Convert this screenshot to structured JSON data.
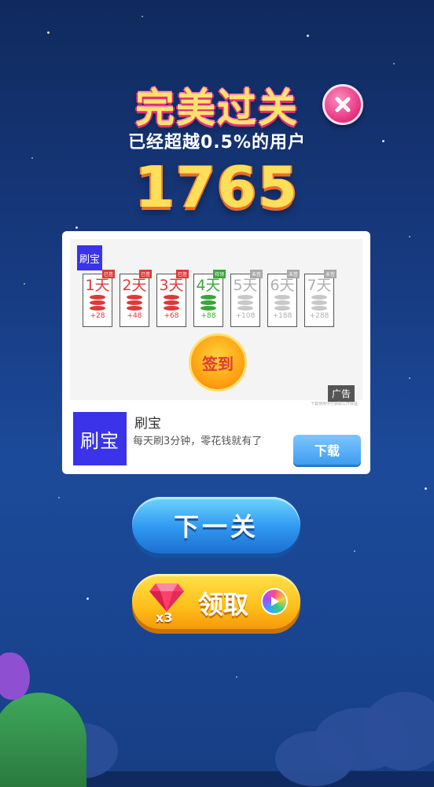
{
  "header": {
    "title": "完美过关",
    "subtitle": "已经超越0.5%的用户",
    "score": "1765"
  },
  "ad": {
    "logo_small": "刷宝",
    "days": [
      {
        "label": "1天",
        "tag": "已签",
        "amount": "+28",
        "state": "claimed"
      },
      {
        "label": "2天",
        "tag": "已签",
        "amount": "+48",
        "state": "claimed"
      },
      {
        "label": "3天",
        "tag": "已签",
        "amount": "+68",
        "state": "claimed"
      },
      {
        "label": "4天",
        "tag": "待领",
        "amount": "+88",
        "state": "current"
      },
      {
        "label": "5天",
        "tag": "未签",
        "amount": "+108",
        "state": "locked"
      },
      {
        "label": "6天",
        "tag": "未签",
        "amount": "+188",
        "state": "locked"
      },
      {
        "label": "7天",
        "tag": "未签",
        "amount": "+288",
        "state": "locked"
      }
    ],
    "signin_label": "签到",
    "ad_tag": "广告",
    "ad_note": "下载使用中已获取公开收益",
    "app_icon_text": "刷宝",
    "app_name": "刷宝",
    "app_desc": "每天刷3分钟，零花钱就有了",
    "download_label": "下载"
  },
  "buttons": {
    "next_label": "下一关",
    "claim_label": "领取",
    "gem_count": "x3"
  },
  "colors": {
    "claimed": "#e03838",
    "current": "#3aa63a",
    "locked": "#b0b0b0",
    "ad_brand": "#3a33ea"
  }
}
